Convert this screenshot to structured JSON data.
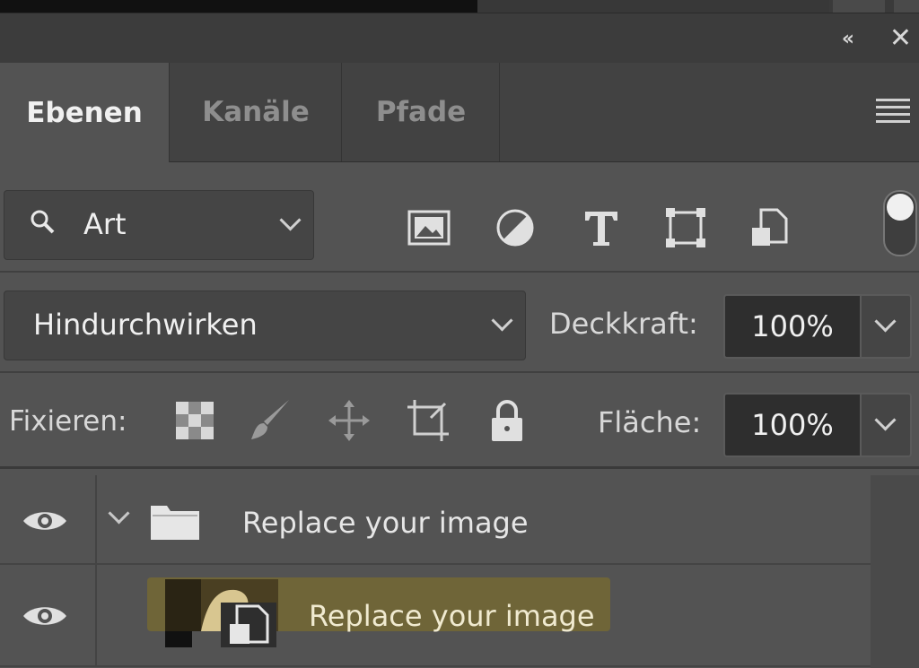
{
  "tabs": [
    {
      "label": "Ebenen",
      "active": true
    },
    {
      "label": "Kanäle",
      "active": false
    },
    {
      "label": "Pfade",
      "active": false
    }
  ],
  "filter": {
    "kind_label": "Art",
    "icons": [
      "image-filter-icon",
      "adjustment-filter-icon",
      "type-filter-icon",
      "shape-filter-icon",
      "smart-object-filter-icon"
    ]
  },
  "blend": {
    "mode": "Hindurchwirken",
    "opacity_label": "Deckkraft:",
    "opacity_value": "100%"
  },
  "lock": {
    "label": "Fixieren:",
    "fill_label": "Fläche:",
    "fill_value": "100%"
  },
  "layers": [
    {
      "name": "Replace your image",
      "type": "group",
      "expanded": true
    },
    {
      "name": "Replace your image",
      "type": "smart-object",
      "selected": true
    }
  ],
  "colors": {
    "panel_bg": "#535353",
    "highlight": "#6f6538"
  }
}
